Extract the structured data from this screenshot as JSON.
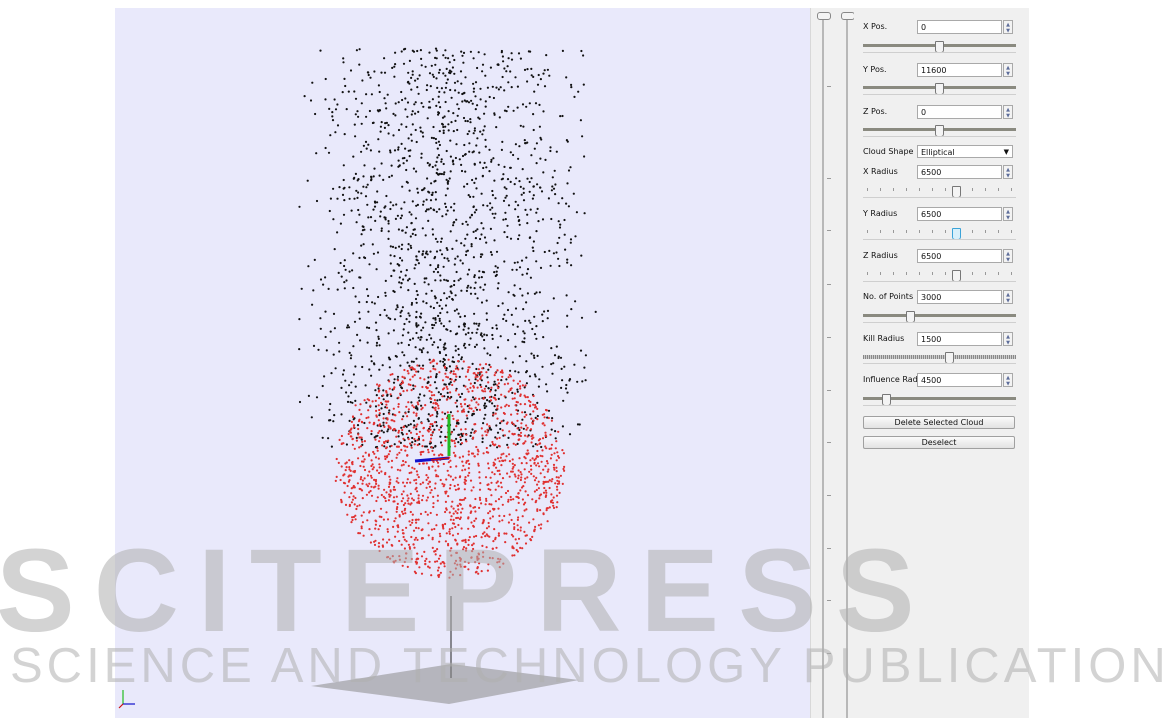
{
  "panel": {
    "x_pos": {
      "label": "X Pos.",
      "value": "0",
      "slider": 0.5
    },
    "y_pos": {
      "label": "Y Pos.",
      "value": "11600",
      "slider": 0.5
    },
    "z_pos": {
      "label": "Z Pos.",
      "value": "0",
      "slider": 0.5
    },
    "cloud_shape": {
      "label": "Cloud Shape",
      "value": "Elliptical"
    },
    "x_radius": {
      "label": "X Radius",
      "value": "6500",
      "slider": 0.62
    },
    "y_radius": {
      "label": "Y Radius",
      "value": "6500",
      "slider": 0.62
    },
    "z_radius": {
      "label": "Z Radius",
      "value": "6500",
      "slider": 0.62
    },
    "num_points": {
      "label": "No. of Points",
      "value": "3000",
      "slider": 0.3
    },
    "kill_radius": {
      "label": "Kill Radius",
      "value": "1500",
      "slider": 0.57
    },
    "influence_rad": {
      "label": "Influence Rad.",
      "value": "4500",
      "slider": 0.13
    },
    "delete_button": "Delete Selected Cloud",
    "deselect_button": "Deselect"
  },
  "watermark": {
    "big": "SCITEPRESS",
    "small": "SCIENCE AND TECHNOLOGY PUBLICATIONS"
  },
  "colors": {
    "viewport_bg": "#e9e9fb",
    "black_points": "#111111",
    "red_points": "#e03030",
    "axis_x": "#1010cc",
    "axis_y": "#22bb22",
    "axis_z": "#cc1111"
  }
}
